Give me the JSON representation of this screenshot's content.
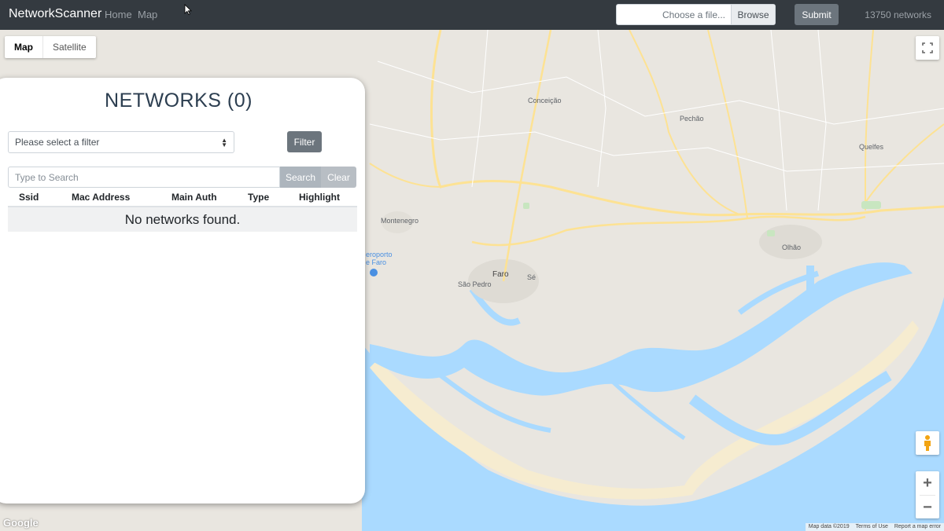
{
  "navbar": {
    "brand": "NetworkScanner",
    "links": [
      "Home",
      "Map"
    ],
    "file_label": "Choose a file...",
    "browse_label": "Browse",
    "submit_label": "Submit",
    "network_count": "13750 networks"
  },
  "map": {
    "type_controls": [
      "Map",
      "Satellite"
    ],
    "active_type": "Map",
    "places": {
      "conceicao": "Conceição",
      "pechao": "Pechão",
      "quelfes": "Quelfes",
      "montenegro": "Montenegro",
      "aeroporto_1": "eroporto",
      "aeroporto_2": "e Faro",
      "faro": "Faro",
      "se": "Sé",
      "sao_pedro": "São Pedro",
      "olhao": "Olhão"
    },
    "zoom_in": "+",
    "zoom_out": "−",
    "logo": "Google",
    "attribution": [
      "Map data ©2019",
      "Terms of Use",
      "Report a map error"
    ],
    "colors": {
      "land": "#e9e6e0",
      "water": "#aadaff",
      "road": "#fde293"
    }
  },
  "panel": {
    "title": "NETWORKS (0)",
    "filter_placeholder": "Please select a filter",
    "filter_button": "Filter",
    "search_placeholder": "Type to Search",
    "search_button": "Search",
    "clear_button": "Clear",
    "columns": [
      "Ssid",
      "Mac Address",
      "Main Auth",
      "Type",
      "Highlight"
    ],
    "empty_message": "No networks found."
  }
}
